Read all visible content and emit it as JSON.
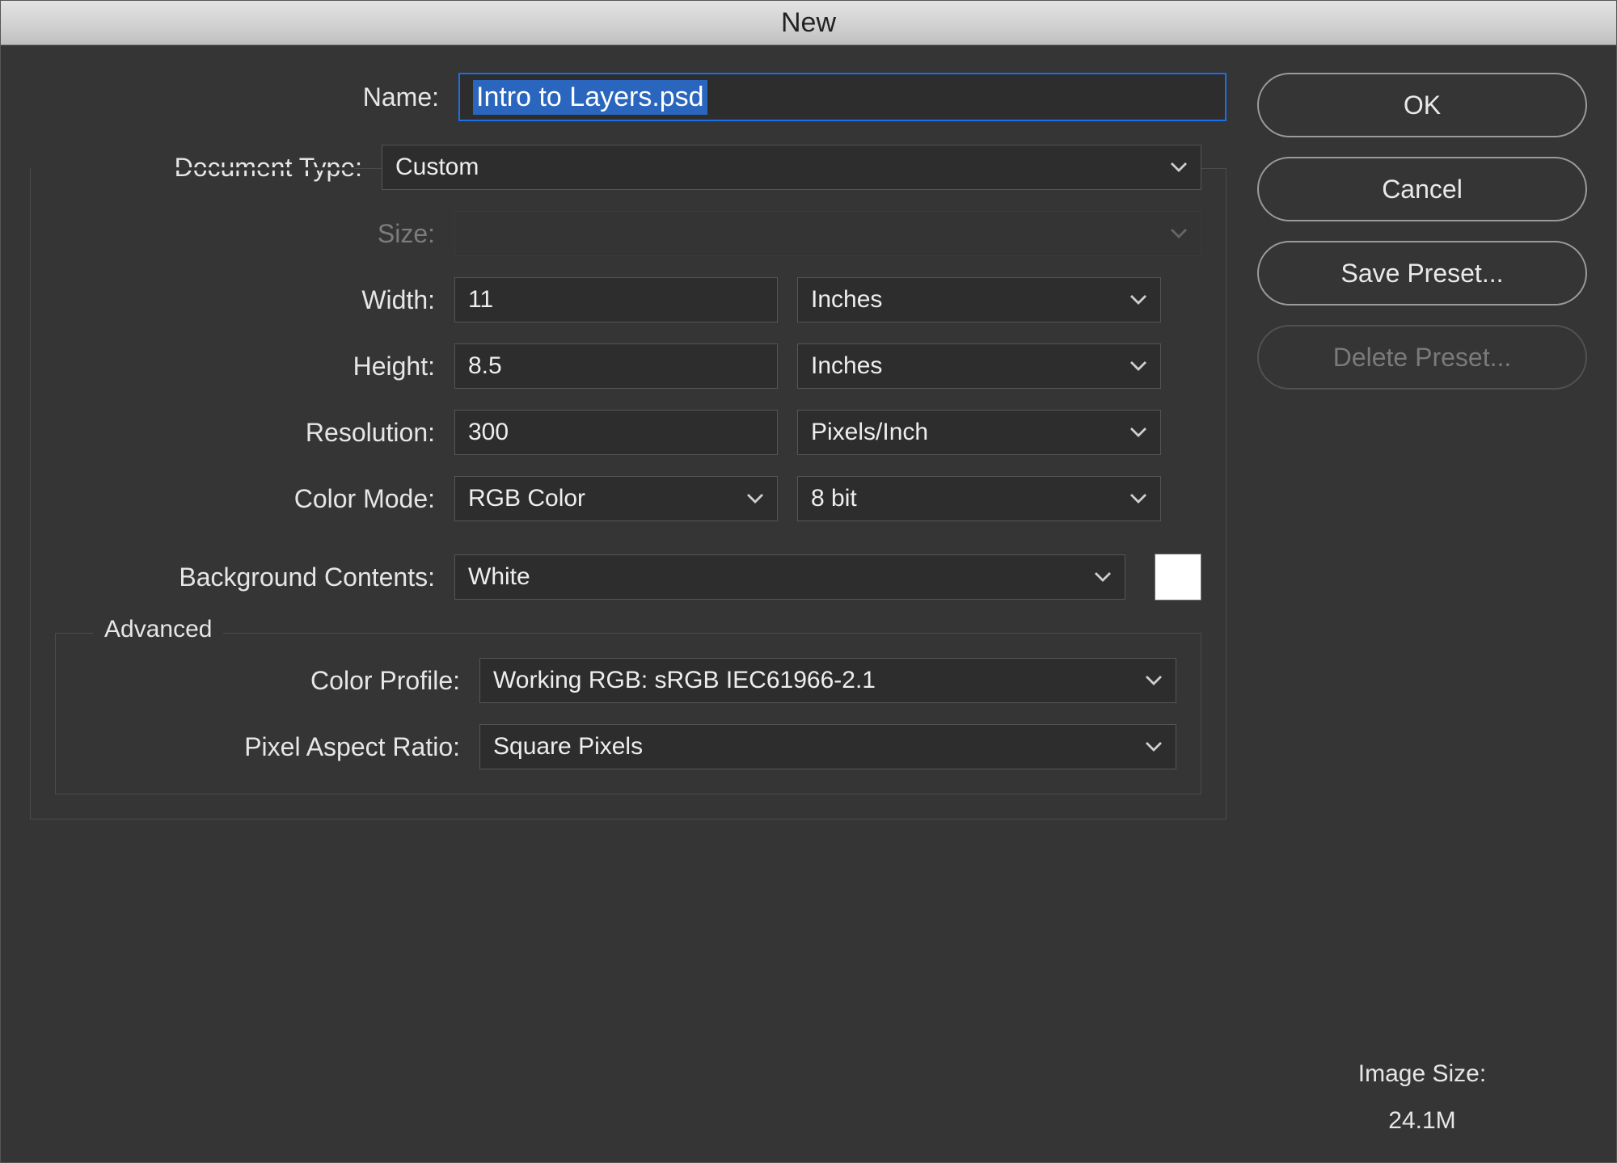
{
  "window": {
    "title": "New"
  },
  "labels": {
    "name": "Name:",
    "document_type": "Document Type:",
    "size": "Size:",
    "width": "Width:",
    "height": "Height:",
    "resolution": "Resolution:",
    "color_mode": "Color Mode:",
    "background_contents": "Background Contents:",
    "advanced": "Advanced",
    "color_profile": "Color Profile:",
    "pixel_aspect_ratio": "Pixel Aspect Ratio:",
    "image_size": "Image Size:"
  },
  "fields": {
    "name": "Intro to Layers.psd",
    "document_type": "Custom",
    "size": "",
    "width": "11",
    "width_unit": "Inches",
    "height": "8.5",
    "height_unit": "Inches",
    "resolution": "300",
    "resolution_unit": "Pixels/Inch",
    "color_mode": "RGB Color",
    "color_mode_depth": "8 bit",
    "background_contents": "White",
    "background_swatch": "#ffffff",
    "color_profile": "Working RGB:  sRGB IEC61966-2.1",
    "pixel_aspect_ratio": "Square Pixels"
  },
  "image_size": "24.1M",
  "buttons": {
    "ok": "OK",
    "cancel": "Cancel",
    "save_preset": "Save Preset...",
    "delete_preset": "Delete Preset..."
  }
}
